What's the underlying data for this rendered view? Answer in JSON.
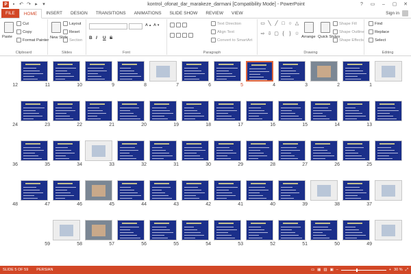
{
  "app": {
    "logo_letter": "P",
    "doc_title": "kontrol_ofonat_dar_marakeze_darmani [Compatibility Mode] - PowerPoint",
    "window_controls": [
      "?",
      "▭",
      "–",
      "▢",
      "✕"
    ],
    "sign_in": "Sign in"
  },
  "tabs": [
    "FILE",
    "HOME",
    "INSERT",
    "DESIGN",
    "TRANSITIONS",
    "ANIMATIONS",
    "SLIDE SHOW",
    "REVIEW",
    "VIEW"
  ],
  "active_tab": "HOME",
  "ribbon": {
    "clipboard": {
      "paste": "Paste",
      "cut": "Cut",
      "copy": "Copy",
      "format_painter": "Format Painter",
      "label": "Clipboard"
    },
    "slides": {
      "new_slide": "New Slide",
      "layout": "Layout",
      "reset": "Reset",
      "section": "Section",
      "label": "Slides"
    },
    "font": {
      "bold": "B",
      "italic": "I",
      "underline": "U",
      "strike": "S",
      "label": "Font"
    },
    "paragraph": {
      "text_direction": "Text Direction",
      "align_text": "Align Text",
      "convert_smartart": "Convert to SmartArt",
      "label": "Paragraph"
    },
    "drawing": {
      "arrange": "Arrange",
      "quick_styles": "Quick Styles",
      "shape_fill": "Shape Fill",
      "shape_outline": "Shape Outline",
      "shape_effects": "Shape Effects",
      "label": "Drawing"
    },
    "editing": {
      "find": "Find",
      "replace": "Replace",
      "select": "Select",
      "label": "Editing"
    }
  },
  "slides": [
    {
      "n": "1",
      "style": "light"
    },
    {
      "n": "2",
      "style": "blue"
    },
    {
      "n": "3",
      "style": "photo"
    },
    {
      "n": "4",
      "style": "blue"
    },
    {
      "n": "5",
      "style": "blue",
      "selected": true
    },
    {
      "n": "6",
      "style": "blue"
    },
    {
      "n": "7",
      "style": "blue"
    },
    {
      "n": "8",
      "style": "light"
    },
    {
      "n": "9",
      "style": "blue"
    },
    {
      "n": "10",
      "style": "blue"
    },
    {
      "n": "11",
      "style": "blue"
    },
    {
      "n": "12",
      "style": "blue"
    },
    {
      "n": "13",
      "style": "blue"
    },
    {
      "n": "14",
      "style": "blue"
    },
    {
      "n": "15",
      "style": "blue"
    },
    {
      "n": "16",
      "style": "blue"
    },
    {
      "n": "17",
      "style": "blue"
    },
    {
      "n": "18",
      "style": "blue"
    },
    {
      "n": "19",
      "style": "blue"
    },
    {
      "n": "20",
      "style": "blue"
    },
    {
      "n": "21",
      "style": "blue"
    },
    {
      "n": "22",
      "style": "blue"
    },
    {
      "n": "23",
      "style": "blue"
    },
    {
      "n": "24",
      "style": "blue"
    },
    {
      "n": "25",
      "style": "blue"
    },
    {
      "n": "26",
      "style": "blue"
    },
    {
      "n": "27",
      "style": "blue"
    },
    {
      "n": "28",
      "style": "blue"
    },
    {
      "n": "29",
      "style": "blue"
    },
    {
      "n": "30",
      "style": "blue"
    },
    {
      "n": "31",
      "style": "blue"
    },
    {
      "n": "32",
      "style": "blue"
    },
    {
      "n": "33",
      "style": "blue"
    },
    {
      "n": "34",
      "style": "light"
    },
    {
      "n": "35",
      "style": "blue"
    },
    {
      "n": "36",
      "style": "blue"
    },
    {
      "n": "37",
      "style": "light"
    },
    {
      "n": "38",
      "style": "blue"
    },
    {
      "n": "39",
      "style": "light"
    },
    {
      "n": "40",
      "style": "blue"
    },
    {
      "n": "41",
      "style": "blue"
    },
    {
      "n": "42",
      "style": "blue"
    },
    {
      "n": "43",
      "style": "blue"
    },
    {
      "n": "44",
      "style": "blue"
    },
    {
      "n": "45",
      "style": "blue"
    },
    {
      "n": "46",
      "style": "photo"
    },
    {
      "n": "47",
      "style": "blue"
    },
    {
      "n": "48",
      "style": "blue"
    },
    {
      "n": "49",
      "style": "light"
    },
    {
      "n": "50",
      "style": "blue"
    },
    {
      "n": "51",
      "style": "blue"
    },
    {
      "n": "52",
      "style": "blue"
    },
    {
      "n": "53",
      "style": "blue"
    },
    {
      "n": "54",
      "style": "blue"
    },
    {
      "n": "55",
      "style": "blue"
    },
    {
      "n": "56",
      "style": "blue"
    },
    {
      "n": "57",
      "style": "blue"
    },
    {
      "n": "58",
      "style": "photo"
    },
    {
      "n": "59",
      "style": "light"
    }
  ],
  "status": {
    "slide_info": "SLIDE 5 OF 59",
    "language": "PERSIAN",
    "zoom": "30 %",
    "zoom_fraction": 0.33
  },
  "colors": {
    "accent": "#d24726",
    "slide_bg": "#1b2f8a"
  }
}
